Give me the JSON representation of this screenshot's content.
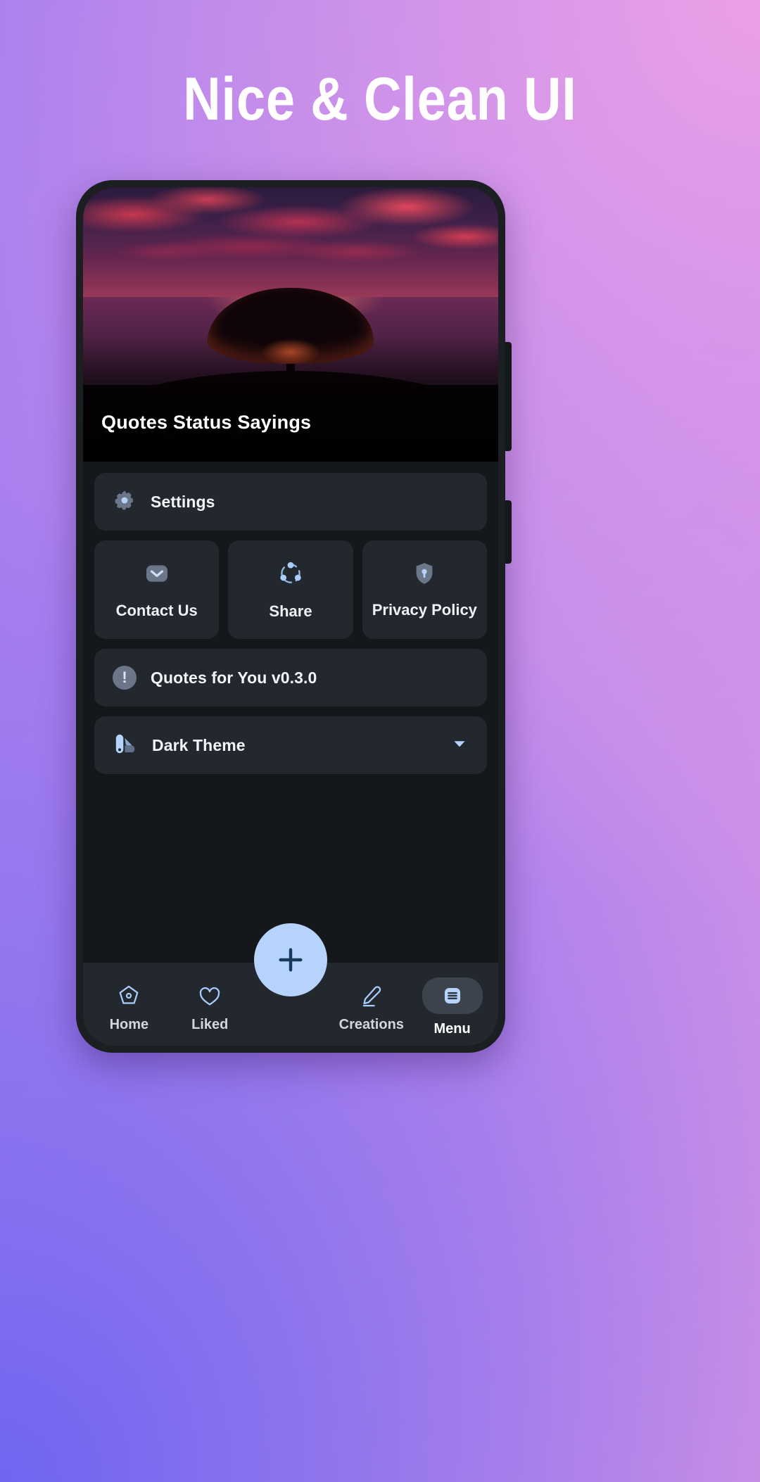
{
  "page": {
    "headline": "Nice & Clean UI",
    "background_start": "#9f7bee",
    "background_end": "#e39ae4"
  },
  "phone": {
    "frame_color": "#1b1f22",
    "side_buttons": [
      "volume-button",
      "power-button"
    ]
  },
  "hero": {
    "title": "Quotes Status Sayings",
    "image_description": "sunset-tree-over-sea"
  },
  "menu": {
    "settings_row": {
      "label": "Settings",
      "icon": "gear-icon",
      "icon_color": "#6b7689",
      "icon_accent": "#b6d4fb"
    },
    "tiles": [
      {
        "label": "Contact Us",
        "icon": "envelope-icon"
      },
      {
        "label": "Share",
        "icon": "share-nodes-icon"
      },
      {
        "label": "Privacy Policy",
        "icon": "shield-lock-icon"
      }
    ],
    "version_row": {
      "label": "Quotes for You v0.3.0",
      "icon": "info-exclamation-icon",
      "icon_glyph": "!"
    },
    "theme_row": {
      "label": "Dark Theme",
      "icon": "color-palette-icon",
      "chevron": "chevron-down-icon"
    },
    "card_color": "#23272e",
    "body_color": "#15181b",
    "accent_color": "#b6d4fb"
  },
  "fab": {
    "label": "+",
    "name": "add-button",
    "color": "#b6d4fb",
    "glyph_color": "#16395c"
  },
  "bottom_nav": [
    {
      "label": "Home",
      "icon": "home-icon",
      "active": false
    },
    {
      "label": "Liked",
      "icon": "heart-icon",
      "active": false
    },
    {
      "label": "Creations",
      "icon": "pencil-edit-icon",
      "active": false
    },
    {
      "label": "Menu",
      "icon": "list-menu-icon",
      "active": true
    }
  ]
}
